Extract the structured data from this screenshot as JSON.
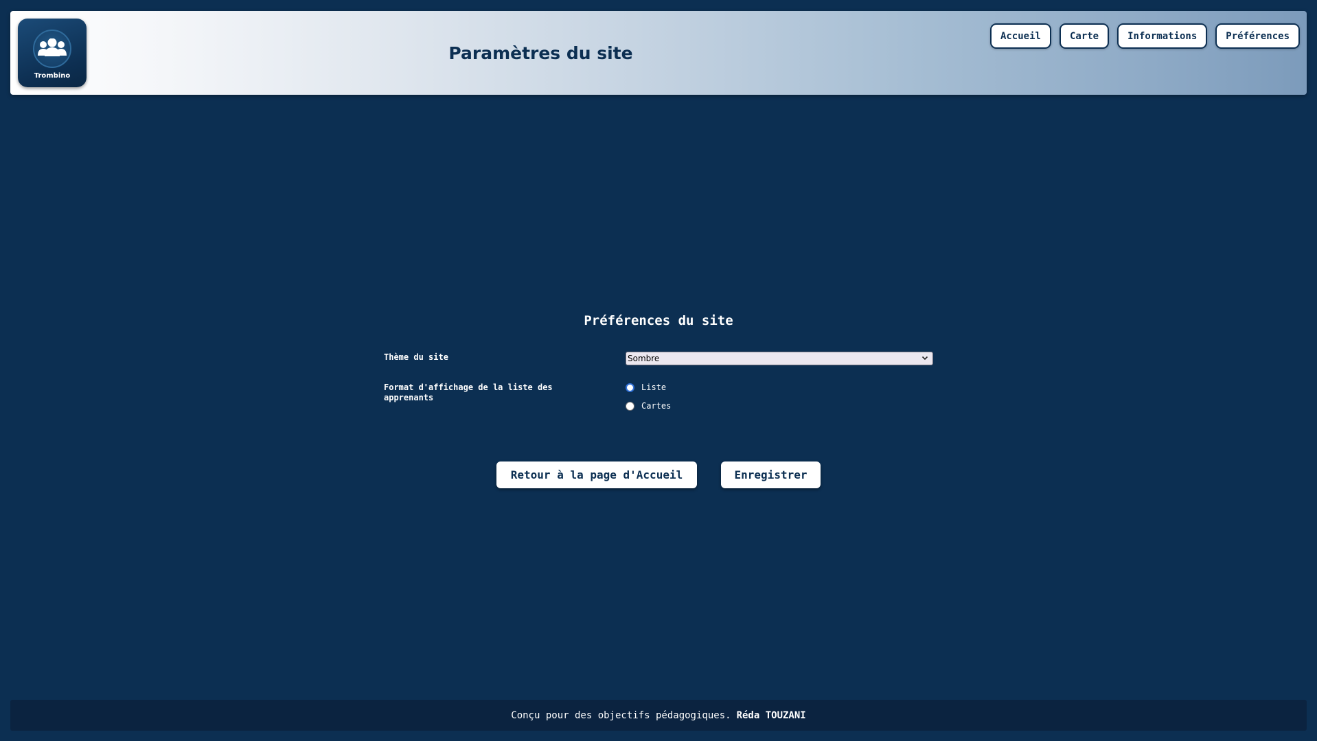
{
  "header": {
    "logo_text": "Trombino",
    "title": "Paramètres du site",
    "nav": [
      {
        "label": "Accueil"
      },
      {
        "label": "Carte"
      },
      {
        "label": "Informations"
      },
      {
        "label": "Préférences"
      }
    ]
  },
  "main": {
    "section_title": "Préférences du site",
    "theme": {
      "label": "Thème du site",
      "selected": "Sombre"
    },
    "display_format": {
      "label": "Format d'affichage de la liste des apprenants",
      "options": [
        {
          "label": "Liste",
          "checked": true
        },
        {
          "label": "Cartes",
          "checked": false
        }
      ]
    },
    "buttons": {
      "back_label": "Retour à la page d'Accueil",
      "save_label": "Enregistrer"
    }
  },
  "footer": {
    "text": "Conçu pour des objectifs pédagogiques.",
    "author": "Réda TOUZANI"
  },
  "colors": {
    "background": "#0c2f52",
    "footer_bg": "#0b2340",
    "radio_accent": "#2f6fd6"
  }
}
